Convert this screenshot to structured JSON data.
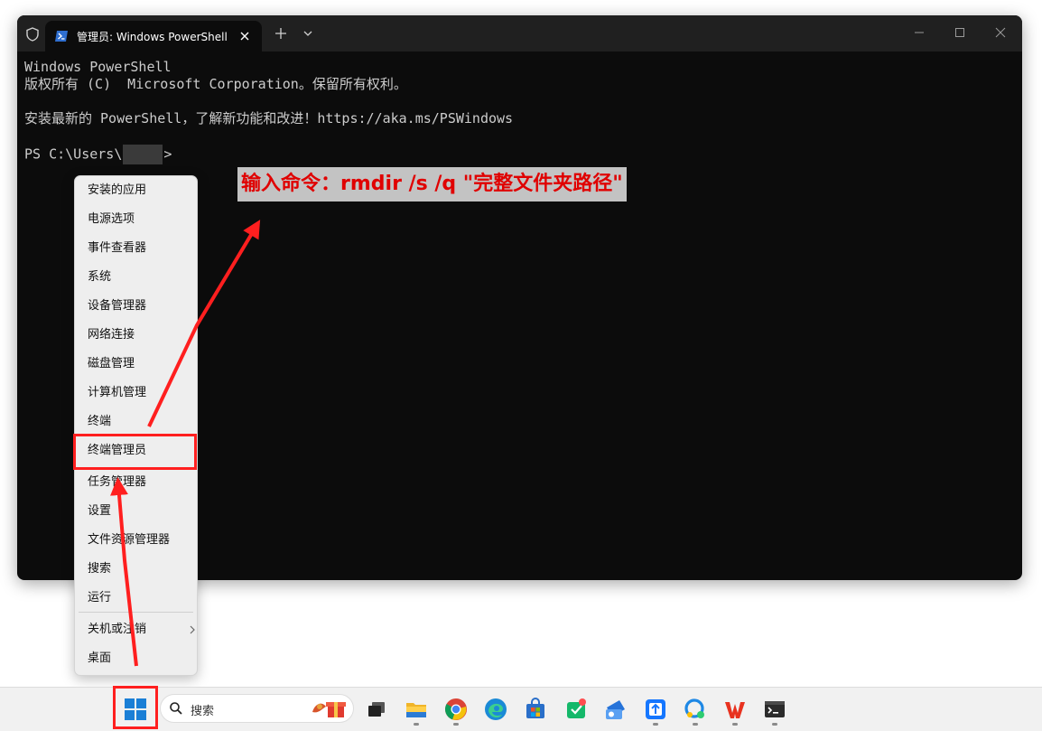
{
  "window": {
    "tab_title": "管理员: Windows PowerShell",
    "new_tab_symbol": "+",
    "dropdown_symbol": "⌄",
    "controls": [
      "minimize-icon",
      "maximize-icon",
      "close-icon"
    ]
  },
  "terminal": {
    "lines": [
      "Windows PowerShell",
      "版权所有 (C)  Microsoft Corporation。保留所有权利。",
      "",
      "安装最新的 PowerShell，了解新功能和改进！https://aka.ms/PSWindows",
      ""
    ],
    "prompt_prefix": "PS C:\\Users\\",
    "prompt_suffix": ">"
  },
  "annotation": {
    "text": "输入命令：rmdir /s /q \"完整文件夹路径\"",
    "color": "#e00000"
  },
  "context_menu": {
    "items": [
      "安装的应用",
      "电源选项",
      "事件查看器",
      "系统",
      "设备管理器",
      "网络连接",
      "磁盘管理",
      "计算机管理",
      "终端",
      "终端管理员",
      "任务管理器",
      "设置",
      "文件资源管理器",
      "搜索",
      "运行",
      "关机或注销",
      "桌面"
    ],
    "highlighted": "终端管理员"
  },
  "taskbar": {
    "search_placeholder": "搜索",
    "apps": [
      "task-view-icon",
      "file-explorer-icon",
      "chrome-icon",
      "edge-icon",
      "microsoft-store-icon",
      "green-app-icon",
      "mail-app-icon",
      "blue-app-icon",
      "chat-app-icon",
      "wps-icon",
      "terminal-icon"
    ]
  },
  "colors": {
    "highlight_border": "#ff1f1f",
    "arrow": "#ff1f1f",
    "terminal_bg": "#0c0c0c",
    "titlebar_bg": "#202020"
  }
}
